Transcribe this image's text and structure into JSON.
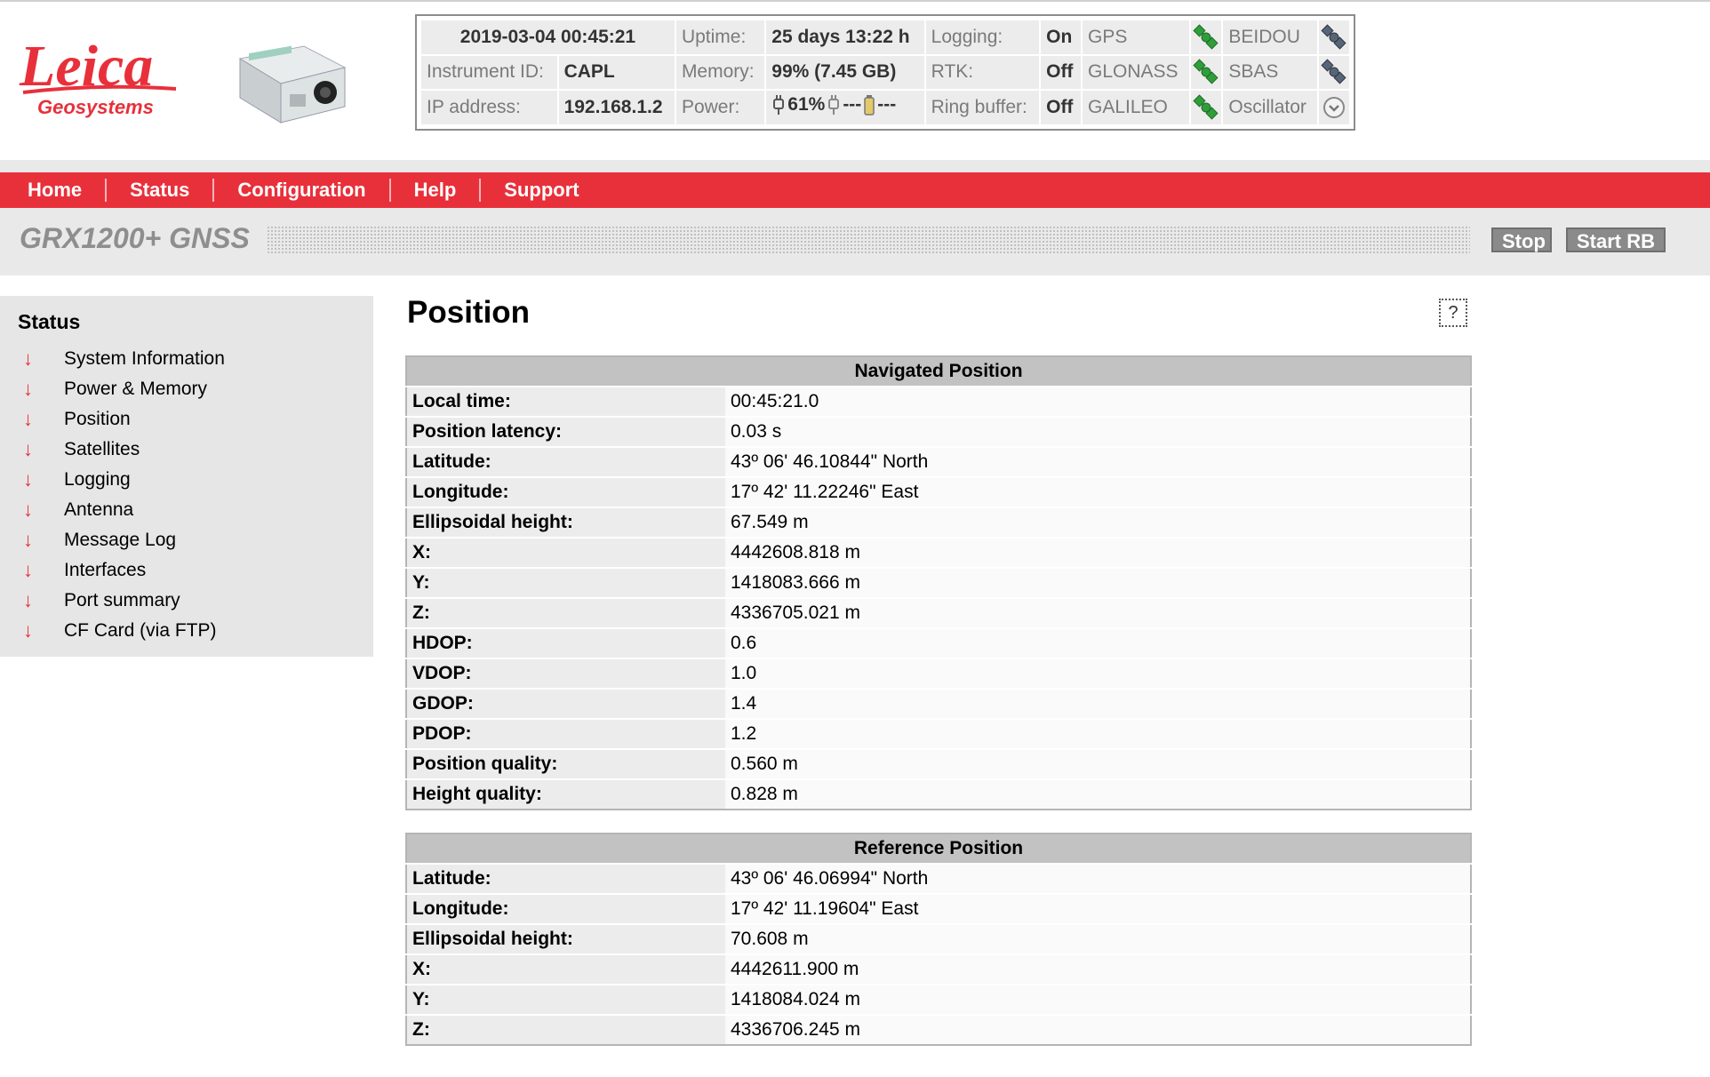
{
  "header": {
    "logo": {
      "brand": "Leica",
      "sub": "Geosystems"
    },
    "status": {
      "datetime": "2019-03-04 00:45:21",
      "uptime_label": "Uptime:",
      "uptime_value": "25 days 13:22 h",
      "logging_label": "Logging:",
      "logging_value": "On",
      "instrument_label": "Instrument ID:",
      "instrument_value": "CAPL",
      "memory_label": "Memory:",
      "memory_value": "99% (7.45 GB)",
      "rtk_label": "RTK:",
      "rtk_value": "Off",
      "ip_label": "IP address:",
      "ip_value": "192.168.1.2",
      "power_label": "Power:",
      "power_plug": "61%",
      "power_ext": "---",
      "power_batt": "---",
      "ringbuffer_label": "Ring buffer:",
      "ringbuffer_value": "Off",
      "gnss": [
        {
          "name": "GPS",
          "state": "active"
        },
        {
          "name": "GLONASS",
          "state": "active"
        },
        {
          "name": "GALILEO",
          "state": "active"
        },
        {
          "name": "BEIDOU",
          "state": "inactive"
        },
        {
          "name": "SBAS",
          "state": "inactive"
        },
        {
          "name": "Oscillator",
          "state": "ok"
        }
      ]
    }
  },
  "nav": [
    "Home",
    "Status",
    "Configuration",
    "Help",
    "Support"
  ],
  "titlebar": {
    "product": "GRX1200+ GNSS",
    "stop": "Stop",
    "start_rb": "Start RB"
  },
  "sidebar": {
    "title": "Status",
    "items": [
      "System Information",
      "Power & Memory",
      "Position",
      "Satellites",
      "Logging",
      "Antenna",
      "Message Log",
      "Interfaces",
      "Port summary",
      "CF Card (via FTP)"
    ]
  },
  "main": {
    "title": "Position",
    "help": "?",
    "navigated": {
      "heading": "Navigated Position",
      "rows": [
        {
          "k": "Local time:",
          "v": "00:45:21.0"
        },
        {
          "k": "Position latency:",
          "v": "0.03 s"
        },
        {
          "k": "Latitude:",
          "v": "43º 06' 46.10844\" North"
        },
        {
          "k": "Longitude:",
          "v": "17º 42' 11.22246\" East"
        },
        {
          "k": "Ellipsoidal height:",
          "v": "67.549 m"
        },
        {
          "k": "X:",
          "v": "4442608.818 m"
        },
        {
          "k": "Y:",
          "v": "1418083.666 m"
        },
        {
          "k": "Z:",
          "v": "4336705.021 m"
        },
        {
          "k": "HDOP:",
          "v": "0.6"
        },
        {
          "k": "VDOP:",
          "v": "1.0"
        },
        {
          "k": "GDOP:",
          "v": "1.4"
        },
        {
          "k": "PDOP:",
          "v": "1.2"
        },
        {
          "k": "Position quality:",
          "v": "0.560 m"
        },
        {
          "k": "Height quality:",
          "v": "0.828 m"
        }
      ]
    },
    "reference": {
      "heading": "Reference Position",
      "rows": [
        {
          "k": "Latitude:",
          "v": "43º 06' 46.06994\" North"
        },
        {
          "k": "Longitude:",
          "v": "17º 42' 11.19604\" East"
        },
        {
          "k": "Ellipsoidal height:",
          "v": "70.608 m"
        },
        {
          "k": "X:",
          "v": "4442611.900 m"
        },
        {
          "k": "Y:",
          "v": "1418084.024 m"
        },
        {
          "k": "Z:",
          "v": "4336706.245 m"
        }
      ]
    }
  },
  "colors": {
    "brand_red": "#e8303b",
    "active_sat": "#2f9e3a",
    "inactive_sat": "#556677"
  }
}
